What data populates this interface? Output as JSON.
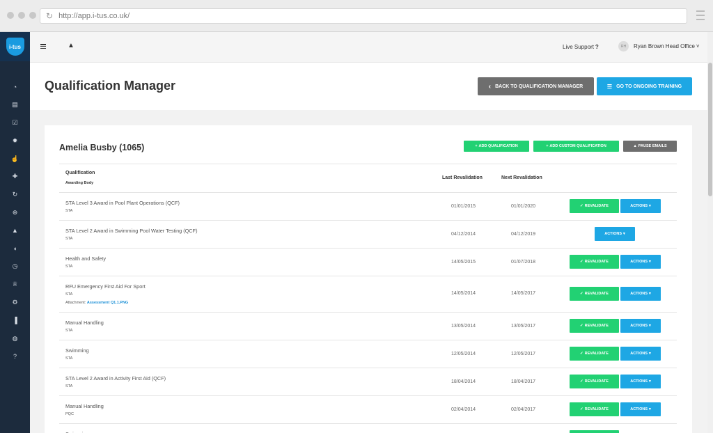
{
  "browser": {
    "url": "http://app.i-tus.co.uk/",
    "reload_icon": "↻"
  },
  "sidebar": {
    "logo_text": "i-tus",
    "icons": [
      {
        "name": "dashboard-icon",
        "glyph": "◔"
      },
      {
        "name": "document-icon",
        "glyph": "▤"
      },
      {
        "name": "checklist-icon",
        "glyph": "☑"
      },
      {
        "name": "certificate-icon",
        "glyph": "✹"
      },
      {
        "name": "thumbs-up-icon",
        "glyph": "☝"
      },
      {
        "name": "first-aid-kit-icon",
        "glyph": "✚"
      },
      {
        "name": "refresh-icon",
        "glyph": "↻"
      },
      {
        "name": "search-plus-icon",
        "glyph": "⊕"
      },
      {
        "name": "graduation-cap-icon",
        "glyph": "▲"
      },
      {
        "name": "shield-icon",
        "glyph": "◖"
      },
      {
        "name": "clock-icon",
        "glyph": "◷"
      },
      {
        "name": "trophy-icon",
        "glyph": "♕"
      },
      {
        "name": "settings-icon",
        "glyph": "⚙"
      },
      {
        "name": "bar-chart-icon",
        "glyph": "▐"
      },
      {
        "name": "globe-icon",
        "glyph": "◍"
      },
      {
        "name": "help-icon",
        "glyph": "?"
      }
    ]
  },
  "header": {
    "bell_icon": "▲",
    "live_support": "Live Support",
    "live_support_q": "?",
    "avatar_initials": "RH",
    "user_name": "Ryan Brown Head Office",
    "user_caret": "˅"
  },
  "page": {
    "title": "Qualification Manager",
    "back_button": "BACK TO QUALIFICATION MANAGER",
    "back_icon": "‹",
    "go_button": "GO TO ONGOING TRAINING",
    "go_icon": "☰"
  },
  "person": {
    "name": "Amelia Busby (1065)",
    "add_qualification": "ADD QUALIFICATION",
    "add_custom_qualification": "ADD CUSTOM QUALIFICATION",
    "pause_emails": "PAUSE EMAILS",
    "plus_icon": "+",
    "bell_icon": "▲"
  },
  "table": {
    "headers": {
      "qualification": "Qualification",
      "awarding_body": "Awarding Body",
      "last": "Last Revalidation",
      "next": "Next Revalidation"
    },
    "revalidate_label": "REVALIDATE",
    "revalidate_icon": "✓",
    "actions_label": "ACTIONS",
    "actions_caret": "▾",
    "attachment_label": "Attachment:",
    "rows": [
      {
        "name": "STA Level 3 Award in Pool Plant Operations (QCF)",
        "body": "STA",
        "last": "01/01/2015",
        "next": "01/01/2020"
      },
      {
        "name": "STA Level 2 Award in Swimming Pool Water Testing (QCF)",
        "body": "STA",
        "last": "04/12/2014",
        "next": "04/12/2019"
      },
      {
        "name": "Health and Safety",
        "body": "STA",
        "last": "14/05/2015",
        "next": "01/07/2018"
      },
      {
        "name": "RFU Emergency First Aid For Sport",
        "body": "STA",
        "last": "14/05/2014",
        "next": "14/05/2017",
        "attachment": "Assessment Q1.1.PNG"
      },
      {
        "name": "Manual Handling",
        "body": "STA",
        "last": "13/05/2014",
        "next": "13/05/2017"
      },
      {
        "name": "Swimming",
        "body": "STA",
        "last": "12/05/2014",
        "next": "12/05/2017"
      },
      {
        "name": "STA Level 2 Award in Activity First Aid (QCF)",
        "body": "STA",
        "last": "18/04/2014",
        "next": "18/04/2017"
      },
      {
        "name": "Manual Handling",
        "body": "PQC",
        "last": "02/04/2014",
        "next": "02/04/2017"
      },
      {
        "name": "Swimming",
        "body": "",
        "last": "",
        "next": ""
      }
    ]
  }
}
